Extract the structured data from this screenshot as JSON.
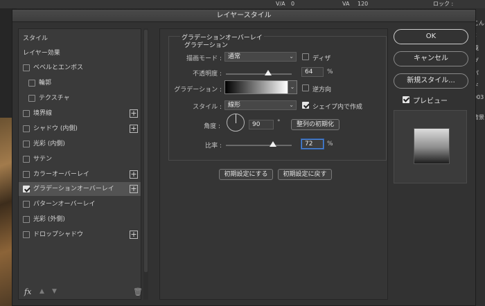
{
  "dialog": {
    "title": "レイヤースタイル"
  },
  "background": {
    "tracking_value": "0",
    "kerning_value": "120",
    "lock_label": "ロック :",
    "side_labels": [
      "こん",
      "x",
      "境",
      "グ",
      "パ",
      "ド",
      "003",
      "背景"
    ]
  },
  "styles": {
    "items": [
      {
        "label": "スタイル",
        "checkbox": false,
        "checked": false,
        "indent": 0,
        "plus": false,
        "selected": false
      },
      {
        "label": "レイヤー効果",
        "checkbox": false,
        "checked": false,
        "indent": 0,
        "plus": false,
        "selected": false
      },
      {
        "label": "ベベルとエンボス",
        "checkbox": true,
        "checked": false,
        "indent": 0,
        "plus": false,
        "selected": false
      },
      {
        "label": "輪郭",
        "checkbox": true,
        "checked": false,
        "indent": 1,
        "plus": false,
        "selected": false
      },
      {
        "label": "テクスチャ",
        "checkbox": true,
        "checked": false,
        "indent": 1,
        "plus": false,
        "selected": false
      },
      {
        "label": "境界線",
        "checkbox": true,
        "checked": false,
        "indent": 0,
        "plus": true,
        "selected": false
      },
      {
        "label": "シャドウ (内側)",
        "checkbox": true,
        "checked": false,
        "indent": 0,
        "plus": true,
        "selected": false
      },
      {
        "label": "光彩 (内側)",
        "checkbox": true,
        "checked": false,
        "indent": 0,
        "plus": false,
        "selected": false
      },
      {
        "label": "サテン",
        "checkbox": true,
        "checked": false,
        "indent": 0,
        "plus": false,
        "selected": false
      },
      {
        "label": "カラーオーバーレイ",
        "checkbox": true,
        "checked": false,
        "indent": 0,
        "plus": true,
        "selected": false
      },
      {
        "label": "グラデーションオーバーレイ",
        "checkbox": true,
        "checked": true,
        "indent": 0,
        "plus": true,
        "selected": true
      },
      {
        "label": "パターンオーバーレイ",
        "checkbox": true,
        "checked": false,
        "indent": 0,
        "plus": false,
        "selected": false
      },
      {
        "label": "光彩 (外側)",
        "checkbox": true,
        "checked": false,
        "indent": 0,
        "plus": false,
        "selected": false
      },
      {
        "label": "ドロップシャドウ",
        "checkbox": true,
        "checked": false,
        "indent": 0,
        "plus": true,
        "selected": false
      }
    ],
    "footer_fx": "fx"
  },
  "gradient_overlay": {
    "section_title": "グラデーションオーバーレイ",
    "sub_title": "グラデーション",
    "blend_mode": {
      "label": "描画モード :",
      "value": "通常"
    },
    "dither": {
      "label": "ディザ",
      "checked": false
    },
    "opacity": {
      "label": "不透明度 :",
      "value": "64",
      "unit": "%",
      "level": 0.64
    },
    "gradient": {
      "label": "グラデーション :",
      "start_color": "#000000",
      "end_color": "#ffffff"
    },
    "reverse": {
      "label": "逆方向",
      "checked": false
    },
    "style": {
      "label": "スタイル :",
      "value": "線形"
    },
    "align_with_layer": {
      "label": "シェイプ内で作成",
      "checked": true
    },
    "angle": {
      "label": "角度 :",
      "value": "90",
      "unit": "°"
    },
    "reset_alignment": "整列の初期化",
    "scale": {
      "label": "比率 :",
      "value": "72",
      "unit": "%",
      "level": 0.72
    },
    "make_default": "初期設定にする",
    "reset_default": "初期設定に戻す"
  },
  "actions": {
    "ok": "OK",
    "cancel": "キャンセル",
    "new_style": "新規スタイル...",
    "preview": {
      "label": "プレビュー",
      "checked": true
    }
  },
  "colors": {
    "accent": "#4d86d9",
    "panel": "#323232",
    "selected_row": "#535353"
  }
}
